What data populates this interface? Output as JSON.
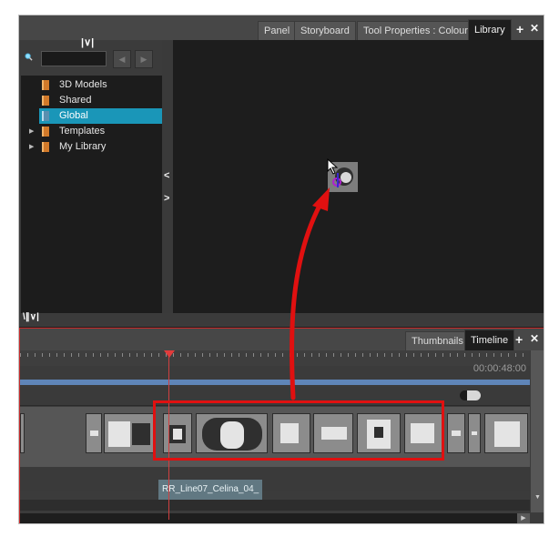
{
  "top_tabs": [
    "Panel",
    "Storyboard",
    "Tool Properties : Colour",
    "Library"
  ],
  "active_tab": "Library",
  "tab_controls": {
    "add": "+",
    "close": "✕"
  },
  "search": {
    "placeholder": ""
  },
  "tree": [
    {
      "label": "3D Models",
      "expandable": false,
      "selected": false
    },
    {
      "label": "Shared",
      "expandable": false,
      "selected": false
    },
    {
      "label": "Global",
      "expandable": false,
      "selected": true
    },
    {
      "label": "Templates",
      "expandable": true,
      "selected": false
    },
    {
      "label": "My Library",
      "expandable": true,
      "selected": false
    }
  ],
  "bottom_tabs": [
    "Thumbnails",
    "Timeline"
  ],
  "bottom_active_tab": "Timeline",
  "time_readout": "00:00:48:00",
  "clip_label": "RR_Line07_Celina_04_",
  "icons": {
    "chevron_down": "chevron-down-icon",
    "chevron_left": "chevron-left-icon",
    "chevron_right": "chevron-right-icon",
    "search": "search-icon",
    "folder": "folder-icon"
  },
  "colors": {
    "selection": "#1a96b8",
    "highlight": "#e01010",
    "playhead": "#e23b3b",
    "clip": "#617882"
  }
}
